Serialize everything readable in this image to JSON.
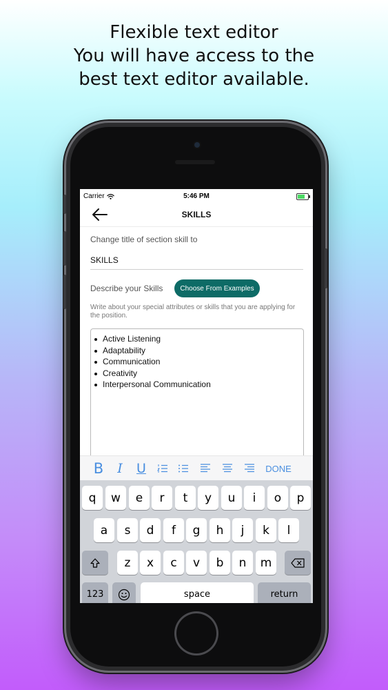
{
  "headline": {
    "line1": "Flexible text editor",
    "line2": "You will have access to the",
    "line3": "best text editor available."
  },
  "status_bar": {
    "carrier": "Carrier",
    "time": "5:46 PM"
  },
  "nav": {
    "title": "SKILLS",
    "back_icon": "arrow-left-icon"
  },
  "form": {
    "section_title_label": "Change title of section skill to",
    "section_title_value": "SKILLS",
    "describe_label": "Describe your Skills",
    "examples_button": "Choose From Examples",
    "helper_text": "Write about your special attributes or skills that you are applying for the position."
  },
  "editor": {
    "items": [
      "Active Listening",
      "Adaptability",
      "Communication",
      "Creativity",
      "Interpersonal Communication"
    ]
  },
  "format_toolbar": {
    "bold": "B",
    "italic": "I",
    "underline": "U",
    "done": "DONE",
    "accent_color": "#4a8fe0"
  },
  "keyboard": {
    "row1": [
      "q",
      "w",
      "e",
      "r",
      "t",
      "y",
      "u",
      "i",
      "o",
      "p"
    ],
    "row2": [
      "a",
      "s",
      "d",
      "f",
      "g",
      "h",
      "j",
      "k",
      "l"
    ],
    "row3": [
      "z",
      "x",
      "c",
      "v",
      "b",
      "n",
      "m"
    ],
    "numbers": "123",
    "space": "space",
    "return": "return"
  },
  "colors": {
    "primary_button": "#0d6b66"
  }
}
